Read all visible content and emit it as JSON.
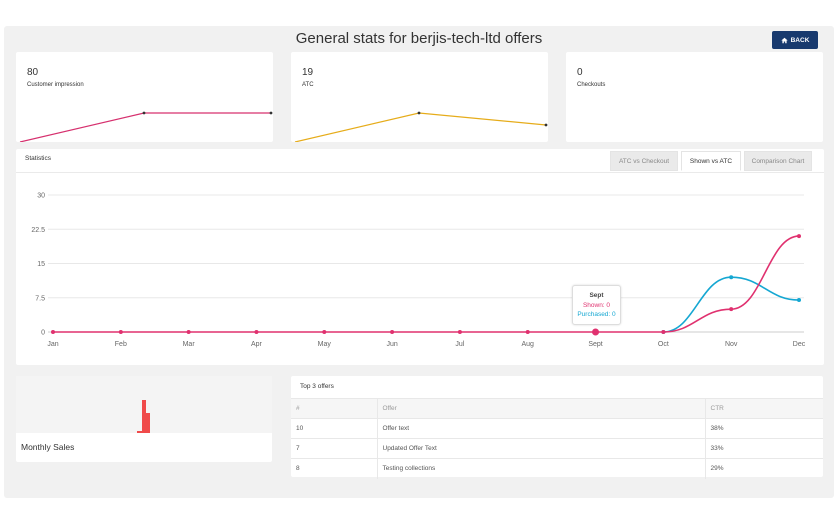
{
  "header": {
    "title": "General stats for berjis-tech-ltd offers",
    "back_label": "BACK"
  },
  "stat_cards": [
    {
      "value": "80",
      "label": "Customer impression",
      "color": "#d6306e"
    },
    {
      "value": "19",
      "label": "ATC",
      "color": "#e6ac1a"
    },
    {
      "value": "0",
      "label": "Checkouts",
      "color": "#999999"
    }
  ],
  "statistics": {
    "title": "Statistics",
    "tabs": [
      {
        "label": "ATC vs Checkout",
        "active": false
      },
      {
        "label": "Shown vs ATC",
        "active": true
      },
      {
        "label": "Comparison Chart",
        "active": false
      }
    ],
    "tooltip": {
      "title": "Sept",
      "shown": "Shown: 0",
      "purchased": "Purchased: 0"
    }
  },
  "chart_data": {
    "type": "line",
    "categories": [
      "Jan",
      "Feb",
      "Mar",
      "Apr",
      "May",
      "Jun",
      "Jul",
      "Aug",
      "Sept",
      "Oct",
      "Nov",
      "Dec"
    ],
    "series": [
      {
        "name": "Shown",
        "color": "#e0316f",
        "values": [
          0,
          0,
          0,
          0,
          0,
          0,
          0,
          0,
          0,
          0,
          5,
          21
        ]
      },
      {
        "name": "Purchased",
        "color": "#15a7d2",
        "values": [
          null,
          null,
          null,
          null,
          null,
          null,
          null,
          null,
          null,
          0,
          12,
          7
        ]
      }
    ],
    "yticks": [
      "0",
      "7.5",
      "15",
      "22.5",
      "30"
    ],
    "ylim": [
      0,
      30
    ],
    "grid": true
  },
  "monthly_sales": {
    "label": "Monthly Sales",
    "bar_color": "#f04a4a"
  },
  "top_offers": {
    "title": "Top 3 offers",
    "columns": [
      "#",
      "Offer",
      "CTR"
    ],
    "rows": [
      [
        "10",
        "Offer text",
        "38%"
      ],
      [
        "7",
        "Updated Offer Text",
        "33%"
      ],
      [
        "8",
        "Testing collections",
        "29%"
      ]
    ]
  }
}
